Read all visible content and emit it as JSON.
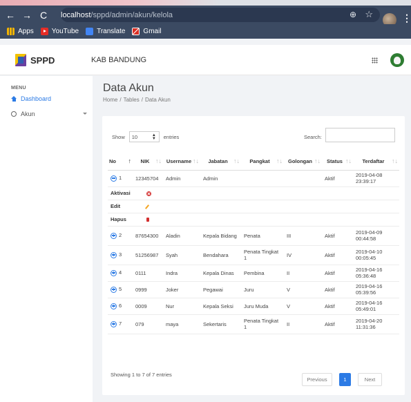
{
  "browser": {
    "url_host": "localhost",
    "url_path": "/sppd/admin/akun/kelola",
    "bookmarks": [
      "Apps",
      "YouTube",
      "Translate",
      "Gmail"
    ]
  },
  "header": {
    "brand": "SPPD",
    "region": "KAB BANDUNG"
  },
  "sidebar": {
    "menu_heading": "MENU",
    "items": [
      {
        "label": "Dashboard"
      },
      {
        "label": "Akun"
      }
    ]
  },
  "page": {
    "title": "Data Akun",
    "breadcrumb": [
      "Home",
      "/",
      "Tables",
      "/",
      "Data Akun"
    ]
  },
  "table_controls": {
    "show_label": "Show",
    "entries_value": "10",
    "entries_label": "entries",
    "search_label": "Search:"
  },
  "table": {
    "columns": [
      "No",
      "NIK",
      "Username",
      "Jabatan",
      "Pangkat",
      "Golongan",
      "Status",
      "Terdaftar"
    ],
    "rows": [
      {
        "no": "1",
        "nik": "12345704",
        "username": "Admin",
        "jabatan": "Admin",
        "pangkat": "",
        "golongan": "",
        "status": "Aktif",
        "date": "2019-04-08",
        "time": "23:39:17"
      },
      {
        "no": "2",
        "nik": "87654300",
        "username": "Aladin",
        "jabatan": "Kepala Bidang",
        "pangkat": "Penata",
        "golongan": "III",
        "status": "Aktif",
        "date": "2019-04-09",
        "time": "00:44:58"
      },
      {
        "no": "3",
        "nik": "51256987",
        "username": "Syah",
        "jabatan": "Bendahara",
        "pangkat": "Penata Tingkat 1",
        "golongan": "IV",
        "status": "Aktif",
        "date": "2019-04-10",
        "time": "00:05:45"
      },
      {
        "no": "4",
        "nik": "0111",
        "username": "Indra",
        "jabatan": "Kepala Dinas",
        "pangkat": "Pembina",
        "golongan": "II",
        "status": "Aktif",
        "date": "2019-04-16",
        "time": "05:36:48"
      },
      {
        "no": "5",
        "nik": "0999",
        "username": "Joker",
        "jabatan": "Pegawai",
        "pangkat": "Juru",
        "golongan": "V",
        "status": "Aktif",
        "date": "2019-04-16",
        "time": "05:39:56"
      },
      {
        "no": "6",
        "nik": "0009",
        "username": "Nur",
        "jabatan": "Kepala Seksi",
        "pangkat": "Juru Muda",
        "golongan": "V",
        "status": "Aktif",
        "date": "2019-04-16",
        "time": "05:49:01"
      },
      {
        "no": "7",
        "nik": "079",
        "username": "maya",
        "jabatan": "Sekertaris",
        "pangkat": "Penata Tingkat 1",
        "golongan": "II",
        "status": "Aktif",
        "date": "2019-04-20",
        "time": "11:31:36"
      }
    ],
    "child_actions": [
      "Aktivasi",
      "Edit",
      "Hapus"
    ]
  },
  "footer": {
    "info": "Showing 1 to 7 of 7 entries",
    "prev": "Previous",
    "current_page": "1",
    "next": "Next"
  }
}
